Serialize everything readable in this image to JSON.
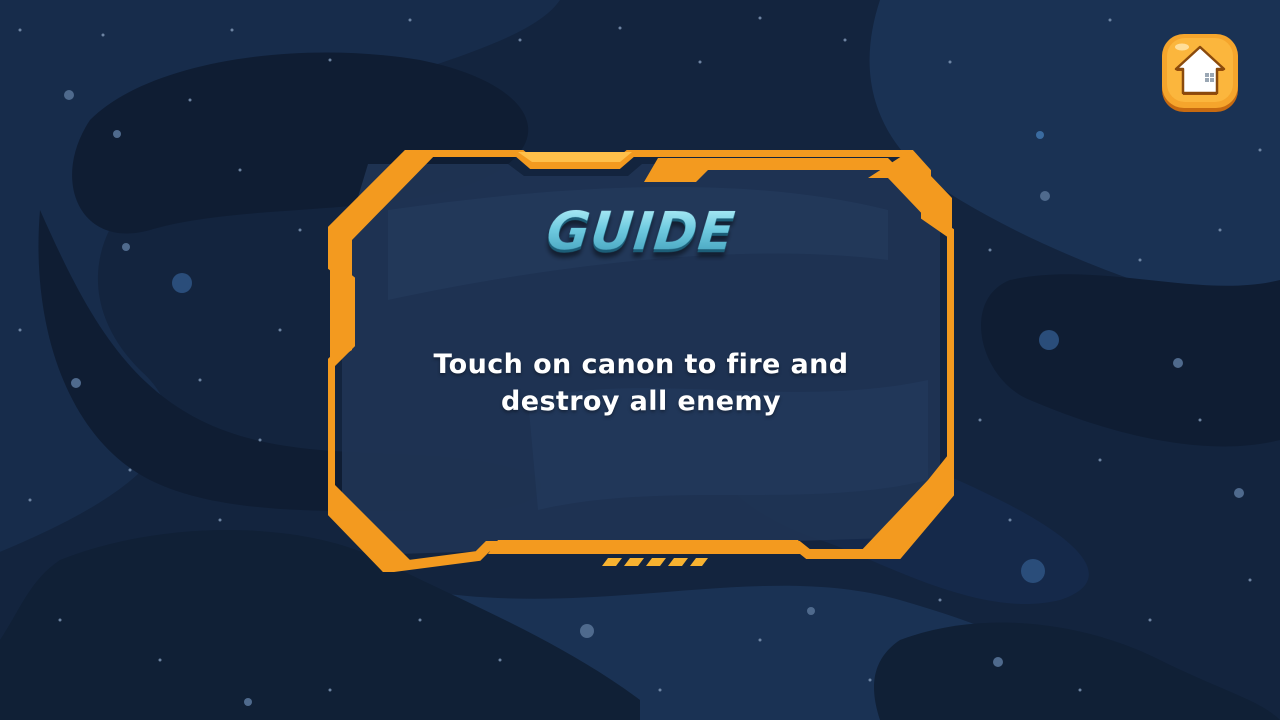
{
  "guide": {
    "title": "GUIDE",
    "message": "Touch on canon to fire and destroy all enemy"
  },
  "colors": {
    "background": "#13243e",
    "nebula_light": "#1d3658",
    "nebula_dark": "#0f1d33",
    "frame_orange": "#f39a1f",
    "panel_fill": "#1f3454",
    "title_cyan": "#7fd4e6",
    "text_white": "#ffffff"
  },
  "icons": {
    "home": "home-icon"
  }
}
